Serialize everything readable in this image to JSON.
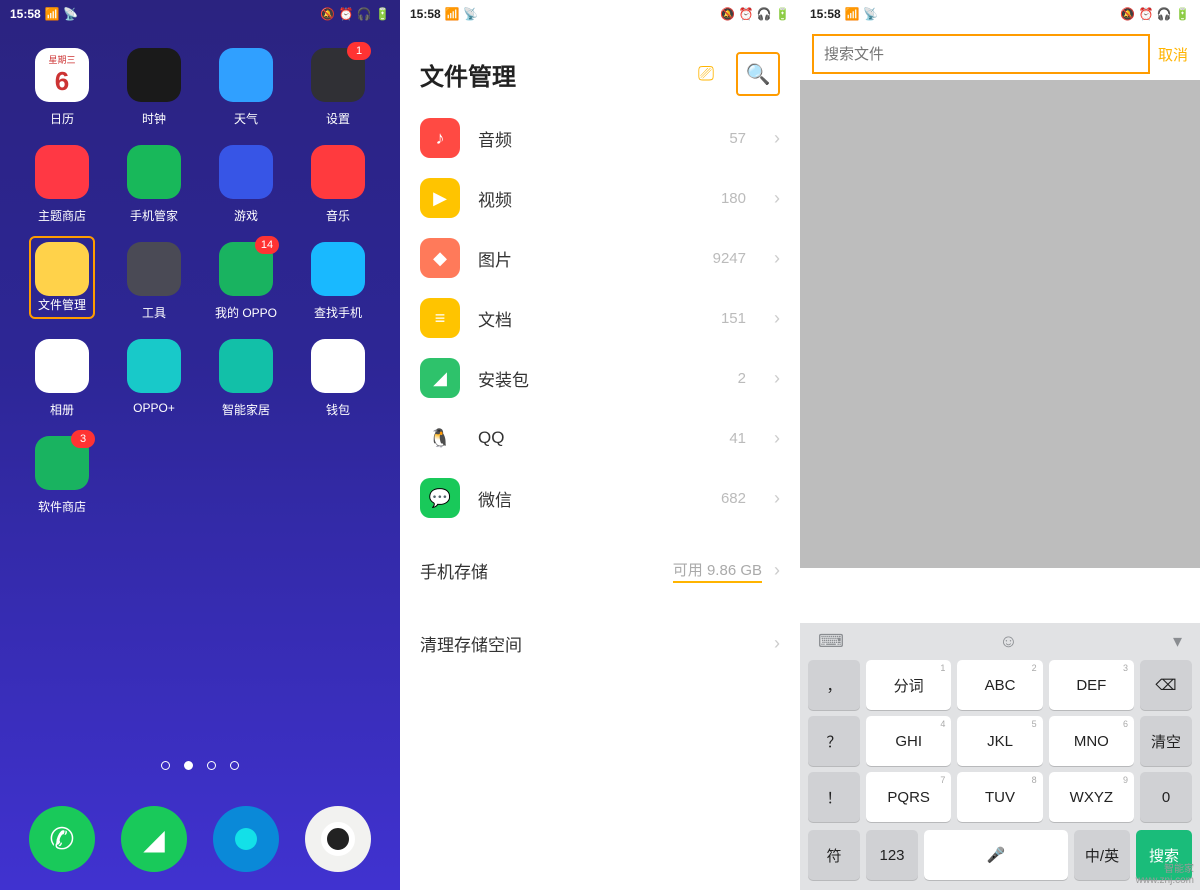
{
  "status": {
    "time": "15:58",
    "icons": "📶 📡",
    "right": "🔕 ⏰ 🎧 🔋"
  },
  "home": {
    "apps": [
      {
        "label": "日历",
        "top": "星期三",
        "num": "6",
        "bg": "#fff"
      },
      {
        "label": "时钟",
        "bg": "#1a1a1a"
      },
      {
        "label": "天气",
        "bg": "#30a0ff"
      },
      {
        "label": "设置",
        "bg": "#303035",
        "badge": "1"
      },
      {
        "label": "主题商店",
        "bg": "#ff3844"
      },
      {
        "label": "手机管家",
        "bg": "#18b85a"
      },
      {
        "label": "游戏",
        "bg": "#3755e6"
      },
      {
        "label": "音乐",
        "bg": "#ff3a3e"
      },
      {
        "label": "文件管理",
        "bg": "#ffd24a",
        "hl": true
      },
      {
        "label": "工具",
        "bg": "#4a4a55"
      },
      {
        "label": "我的 OPPO",
        "bg": "#19b360",
        "badge": "14"
      },
      {
        "label": "查找手机",
        "bg": "#19b9ff"
      },
      {
        "label": "相册",
        "bg": "#fff"
      },
      {
        "label": "OPPO+",
        "bg": "#18c9c9"
      },
      {
        "label": "智能家居",
        "bg": "#12c0a8"
      },
      {
        "label": "钱包",
        "bg": "#fff"
      },
      {
        "label": "软件商店",
        "bg": "#19b360",
        "badge": "3"
      }
    ],
    "dock": [
      {
        "name": "phone",
        "bg": "#19c95a"
      },
      {
        "name": "messages",
        "bg": "#19c95a"
      },
      {
        "name": "browser",
        "bg": "#0a89d8"
      },
      {
        "name": "camera",
        "bg": "#f2f2f0"
      }
    ]
  },
  "fm": {
    "title": "文件管理",
    "cats": [
      {
        "name": "音频",
        "count": "57",
        "bg": "#ff4a43",
        "glyph": "♪"
      },
      {
        "name": "视频",
        "count": "180",
        "bg": "#ffc400",
        "glyph": "▶"
      },
      {
        "name": "图片",
        "count": "9247",
        "bg": "#ff7a5a",
        "glyph": "◆"
      },
      {
        "name": "文档",
        "count": "151",
        "bg": "#ffc400",
        "glyph": "≡"
      },
      {
        "name": "安装包",
        "count": "2",
        "bg": "#2ec26b",
        "glyph": "◢"
      },
      {
        "name": "QQ",
        "count": "41",
        "bg": "#fff",
        "glyph": "🐧"
      },
      {
        "name": "微信",
        "count": "682",
        "bg": "#19c95a",
        "glyph": "💬"
      }
    ],
    "storage": {
      "label": "手机存储",
      "avail": "可用 9.86 GB"
    },
    "clean": "清理存储空间"
  },
  "search": {
    "placeholder": "搜索文件",
    "cancel": "取消"
  },
  "kb": {
    "r1": [
      {
        "m": "分词",
        "s": "1"
      },
      {
        "m": "ABC",
        "s": "2"
      },
      {
        "m": "DEF",
        "s": "3"
      }
    ],
    "r2": [
      {
        "m": "GHI",
        "s": "4"
      },
      {
        "m": "JKL",
        "s": "5"
      },
      {
        "m": "MNO",
        "s": "6"
      }
    ],
    "r3": [
      {
        "m": "PQRS",
        "s": "7"
      },
      {
        "m": "TUV",
        "s": "8"
      },
      {
        "m": "WXYZ",
        "s": "9"
      }
    ],
    "side_l": [
      "，",
      "？",
      "！"
    ],
    "side_r": [
      "⌫",
      "清空",
      "0"
    ],
    "bottom": [
      "符",
      "123",
      "🎤",
      "中/英",
      "搜索"
    ]
  },
  "watermark": {
    "a": "智能家",
    "b": "www.znj.com"
  }
}
